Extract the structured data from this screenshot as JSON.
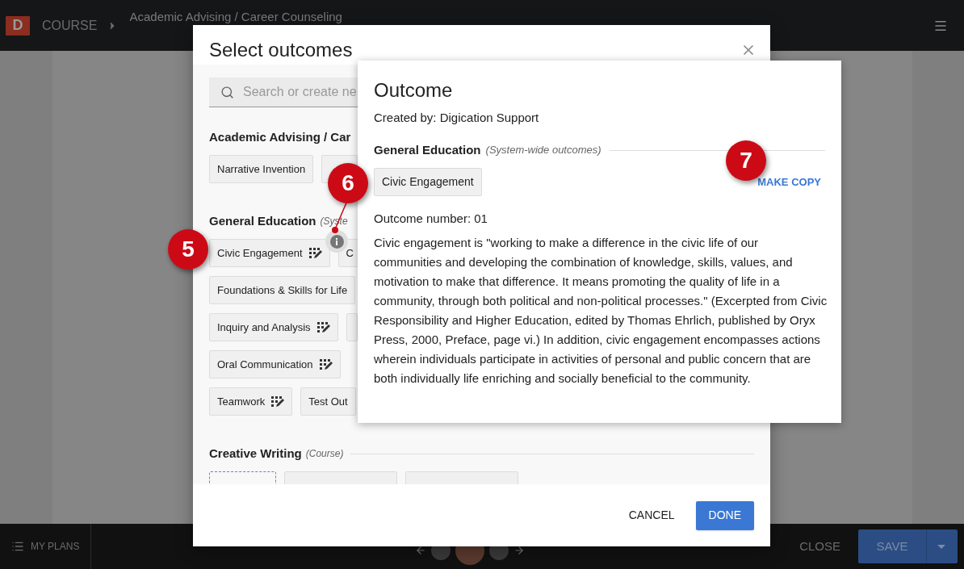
{
  "app_bar": {
    "logo": "D",
    "section": "COURSE",
    "breadcrumb": "Academic Advising / Career Counseling"
  },
  "modal": {
    "title": "Select outcomes",
    "search": {
      "placeholder": "Search or create ne"
    },
    "groups": [
      {
        "title": "Academic Advising / Car",
        "rows": [
          [
            {
              "kind": "chip",
              "label": "Narrative Invention",
              "rubric": false
            },
            {
              "kind": "blank"
            }
          ]
        ]
      },
      {
        "title": "General Education",
        "scope": "(Syste",
        "rows": [
          [
            {
              "kind": "chip",
              "label": "Civic Engagement",
              "rubric": true
            },
            {
              "kind": "chip",
              "label": "C",
              "rubric": false
            }
          ],
          [
            {
              "kind": "chip",
              "label": "Foundations & Skills for Life",
              "rubric": false
            }
          ],
          [
            {
              "kind": "chip",
              "label": "Inquiry and Analysis",
              "rubric": true
            },
            {
              "kind": "blank"
            }
          ],
          [
            {
              "kind": "chip",
              "label": "Oral Communication",
              "rubric": true
            }
          ],
          [
            {
              "kind": "chip",
              "label": "Teamwork",
              "rubric": true
            },
            {
              "kind": "chip",
              "label": "Test Out",
              "rubric": false
            }
          ]
        ]
      },
      {
        "title": "Creative Writing",
        "scope": "(Course)",
        "rows": [
          [
            {
              "kind": "dashed"
            },
            {
              "kind": "blank"
            },
            {
              "kind": "blank"
            }
          ]
        ]
      }
    ],
    "buttons": [
      {
        "label": "CANCEL",
        "kind": "text"
      },
      {
        "label": "DONE",
        "kind": "primary"
      }
    ]
  },
  "popover": {
    "title": "Outcome",
    "created_by": "Created by: Digication Support",
    "group": "General Education",
    "scope": "(System-wide outcomes)",
    "chip": "Civic Engagement",
    "action": "MAKE COPY",
    "number": "Outcome number: 01",
    "description": "Civic engagement is \"working to make a difference in the civic life of our communities and developing the combination of knowledge, skills, values, and motivation to make that difference. It means promoting the quality of life in a community, through both political and non-political processes.\" (Excerpted from Civic Responsibility and Higher Education, edited by Thomas Ehrlich, published by Oryx Press, 2000, Preface, page vi.) In addition, civic engagement encompasses actions wherein individuals participate in activities of personal and public concern that are both individually life enriching and socially beneficial to the community."
  },
  "bottom_bar": {
    "plans": "MY PLANS",
    "close": "CLOSE",
    "save": "SAVE"
  },
  "annotations": [
    {
      "label": "5"
    },
    {
      "label": "6"
    },
    {
      "label": "7"
    }
  ]
}
